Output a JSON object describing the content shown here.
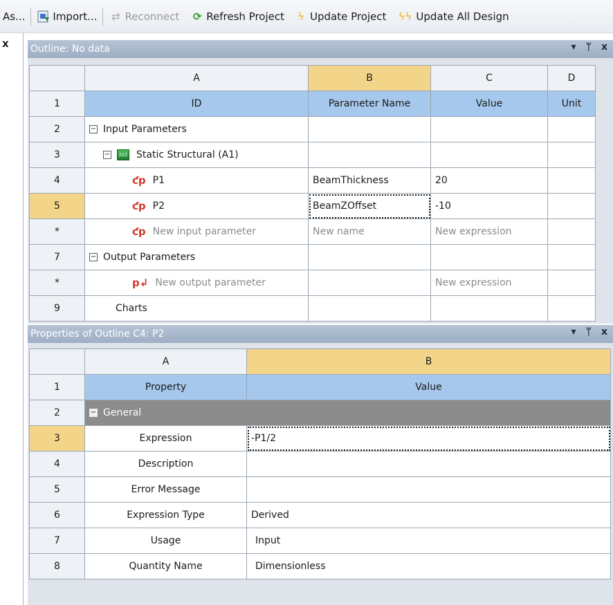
{
  "toolbar": {
    "save_as": "As...",
    "import": "Import...",
    "reconnect": "Reconnect",
    "refresh_project": "Refresh Project",
    "update_project": "Update Project",
    "update_all": "Update All Design"
  },
  "left_strip": {
    "close": "x"
  },
  "outline": {
    "title": "Outline: No data",
    "columns": [
      "A",
      "B",
      "C",
      "D"
    ],
    "header": {
      "id": "ID",
      "parameter_name": "Parameter Name",
      "value": "Value",
      "unit": "Unit"
    },
    "rows": {
      "r2": {
        "num": "2",
        "label": "Input Parameters"
      },
      "r3": {
        "num": "3",
        "label": "Static Structural (A1)"
      },
      "r4": {
        "num": "4",
        "label": "P1",
        "name": "BeamThickness",
        "value": "20"
      },
      "r5": {
        "num": "5",
        "label": "P2",
        "name": "BeamZOffset",
        "value": "-10"
      },
      "r6": {
        "num": "*",
        "label": "New input parameter",
        "name": "New name",
        "value": "New expression"
      },
      "r7": {
        "num": "7",
        "label": "Output Parameters"
      },
      "r8": {
        "num": "*",
        "label": "New output parameter",
        "value": "New expression"
      },
      "r9": {
        "num": "9",
        "label": "Charts"
      }
    },
    "header_row_num": "1"
  },
  "properties": {
    "title": "Properties of Outline C4: P2",
    "columns": [
      "A",
      "B"
    ],
    "header": {
      "property": "Property",
      "value": "Value",
      "num": "1"
    },
    "general": {
      "num": "2",
      "label": "General"
    },
    "rows": [
      {
        "num": "3",
        "property": "Expression",
        "value": "-P1/2"
      },
      {
        "num": "4",
        "property": "Description",
        "value": ""
      },
      {
        "num": "5",
        "property": "Error Message",
        "value": ""
      },
      {
        "num": "6",
        "property": "Expression Type",
        "value": "Derived"
      },
      {
        "num": "7",
        "property": "Usage",
        "value": "Input"
      },
      {
        "num": "8",
        "property": "Quantity Name",
        "value": "Dimensionless"
      }
    ]
  },
  "controls": {
    "dropdown": "▾",
    "pin": "ᛘ",
    "close": "x"
  },
  "icons": {
    "param_input": "ƈp",
    "param_output": "p↲",
    "static_structural": "zzz"
  }
}
